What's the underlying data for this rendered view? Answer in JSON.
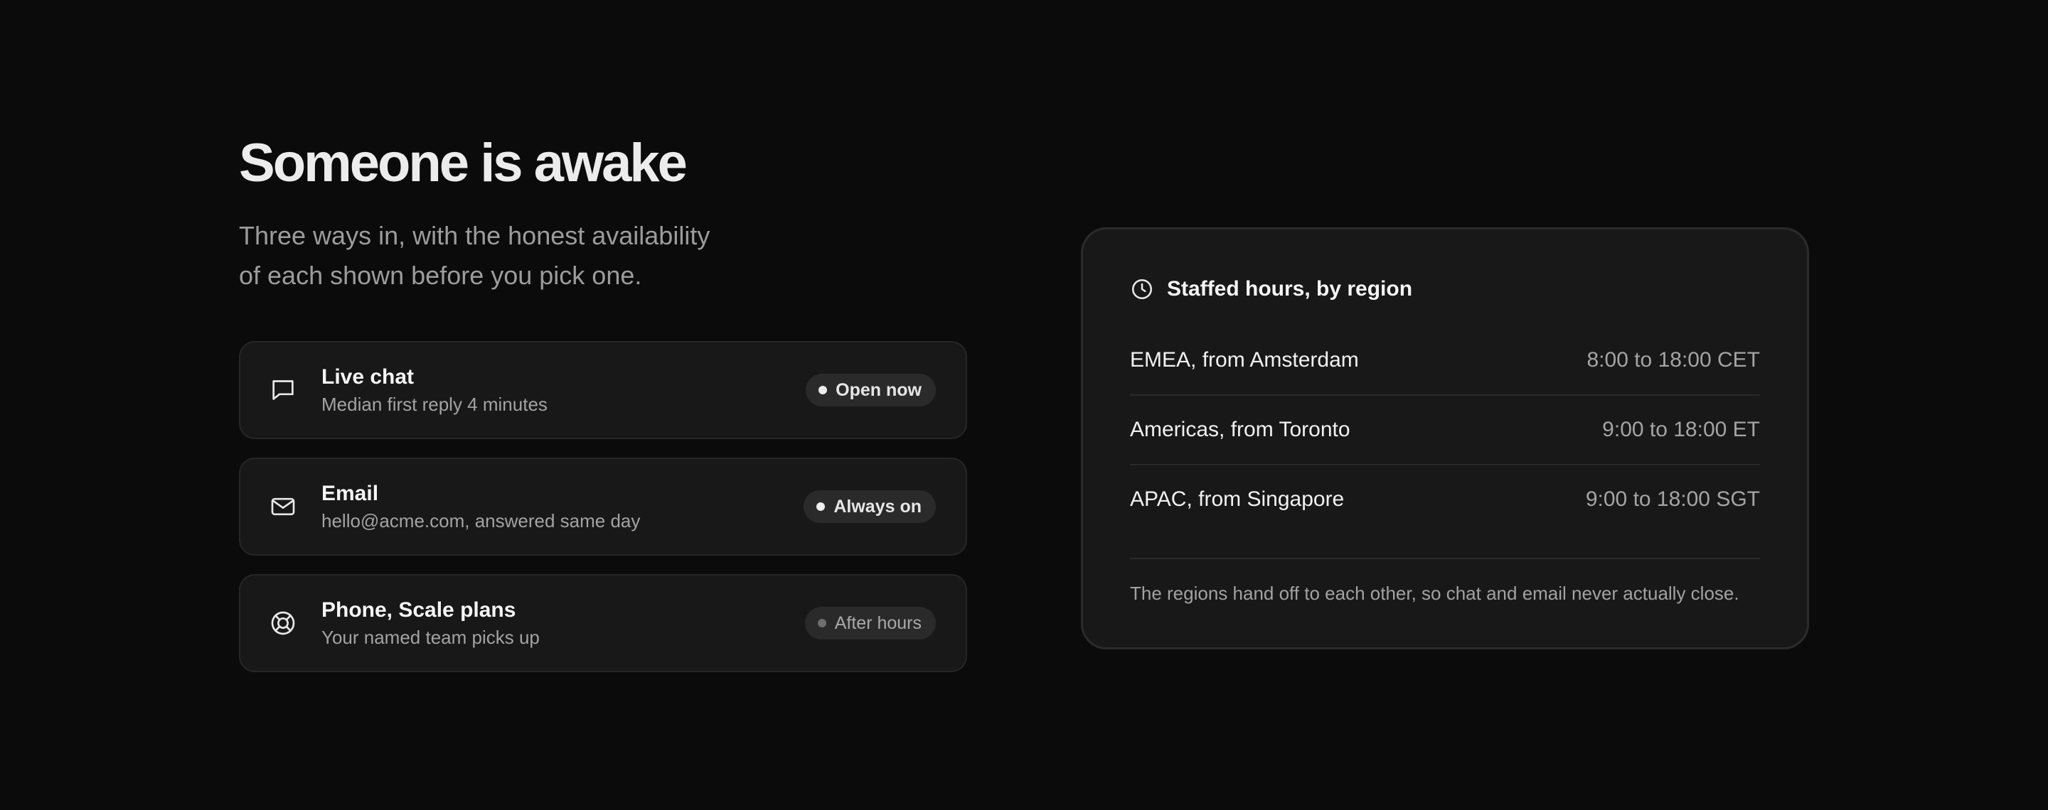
{
  "header": {
    "title": "Someone is awake",
    "subtitle_line1": "Three ways in, with the honest availability",
    "subtitle_line2": "of each shown before you pick one."
  },
  "channels": [
    {
      "icon": "chat-bubble-icon",
      "name": "Live chat",
      "description": "Median first reply 4 minutes",
      "status": "Open now",
      "status_style": "active"
    },
    {
      "icon": "envelope-icon",
      "name": "Email",
      "description": "hello@acme.com, answered same day",
      "status": "Always on",
      "status_style": "active"
    },
    {
      "icon": "lifebuoy-icon",
      "name": "Phone, Scale plans",
      "description": "Your named team picks up",
      "status": "After hours",
      "status_style": "muted"
    }
  ],
  "hours": {
    "icon": "clock-icon",
    "title": "Staffed hours, by region",
    "regions": [
      {
        "name": "EMEA, from Amsterdam",
        "time": "8:00 to 18:00 CET"
      },
      {
        "name": "Americas, from Toronto",
        "time": "9:00 to 18:00 ET"
      },
      {
        "name": "APAC, from Singapore",
        "time": "9:00 to 18:00 SGT"
      }
    ],
    "note": "The regions hand off to each other, so chat and email never actually close."
  },
  "colors": {
    "background": "#0b0b0b",
    "card": "#181818",
    "card_border": "#262626",
    "badge_bg": "#2a2a2a",
    "text_primary": "#f5f5f5",
    "text_secondary": "#a3a3a3",
    "status_dot_active": "#ededed",
    "status_dot_muted": "#6e6e6e"
  }
}
